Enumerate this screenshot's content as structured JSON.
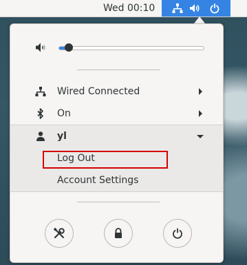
{
  "topbar": {
    "clock": "Wed 00:10",
    "status_icons": [
      "network-wired-icon",
      "volume-icon",
      "power-icon"
    ]
  },
  "menu": {
    "volume": {
      "icon": "speaker-muted-icon",
      "level": 0.07
    },
    "rows": [
      {
        "icon": "network-wired-icon",
        "label": "Wired Connected",
        "has_submenu": true
      },
      {
        "icon": "bluetooth-icon",
        "label": "On",
        "has_submenu": true
      }
    ],
    "user": {
      "icon": "user-icon",
      "name": "yl",
      "expanded": true,
      "items": [
        {
          "label": "Log Out",
          "highlighted": true
        },
        {
          "label": "Account Settings"
        }
      ]
    },
    "actions": [
      "settings-icon",
      "lock-icon",
      "power-icon"
    ]
  },
  "colors": {
    "accent": "#3584e4",
    "highlight_box": "#d40000",
    "menu_bg": "#f6f5f4"
  }
}
